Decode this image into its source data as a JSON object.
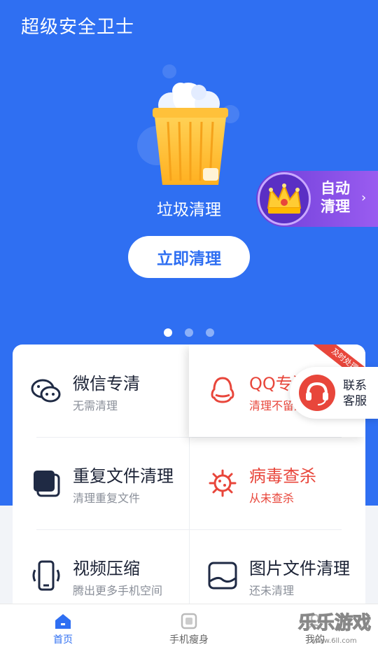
{
  "app": {
    "title": "超级安全卫士"
  },
  "hero": {
    "bin_label": "垃圾清理",
    "clean_button": "立即清理",
    "auto_clean": "自动清理",
    "pages": 3,
    "active_page": 1
  },
  "tiles": [
    {
      "title": "微信专清",
      "subtitle": "无需清理",
      "icon": "wechat-icon",
      "accent": false
    },
    {
      "title": "QQ专清",
      "subtitle": "清理不留痕",
      "icon": "qq-icon",
      "accent": true,
      "ribbon": "及时处理"
    },
    {
      "title": "重复文件清理",
      "subtitle": "清理重复文件",
      "icon": "duplicate-files-icon",
      "accent": false
    },
    {
      "title": "病毒查杀",
      "subtitle": "从未查杀",
      "icon": "virus-icon",
      "accent": true
    },
    {
      "title": "视频压缩",
      "subtitle": "腾出更多手机空间",
      "icon": "phone-video-icon",
      "accent": false
    },
    {
      "title": "图片文件清理",
      "subtitle": "还未清理",
      "icon": "image-icon",
      "accent": false
    }
  ],
  "contact": {
    "label": "联系客服"
  },
  "tabs": [
    {
      "label": "首页",
      "icon": "home-icon",
      "active": true
    },
    {
      "label": "手机瘦身",
      "icon": "slim-icon",
      "active": false
    },
    {
      "label": "我的",
      "icon": "profile-icon",
      "active": false
    }
  ],
  "watermark": {
    "text": "乐乐游戏",
    "url": "www.6ll.com"
  },
  "colors": {
    "primary": "#2f6ff2",
    "accent_red": "#e8463b",
    "purple": "#7b45e0"
  }
}
